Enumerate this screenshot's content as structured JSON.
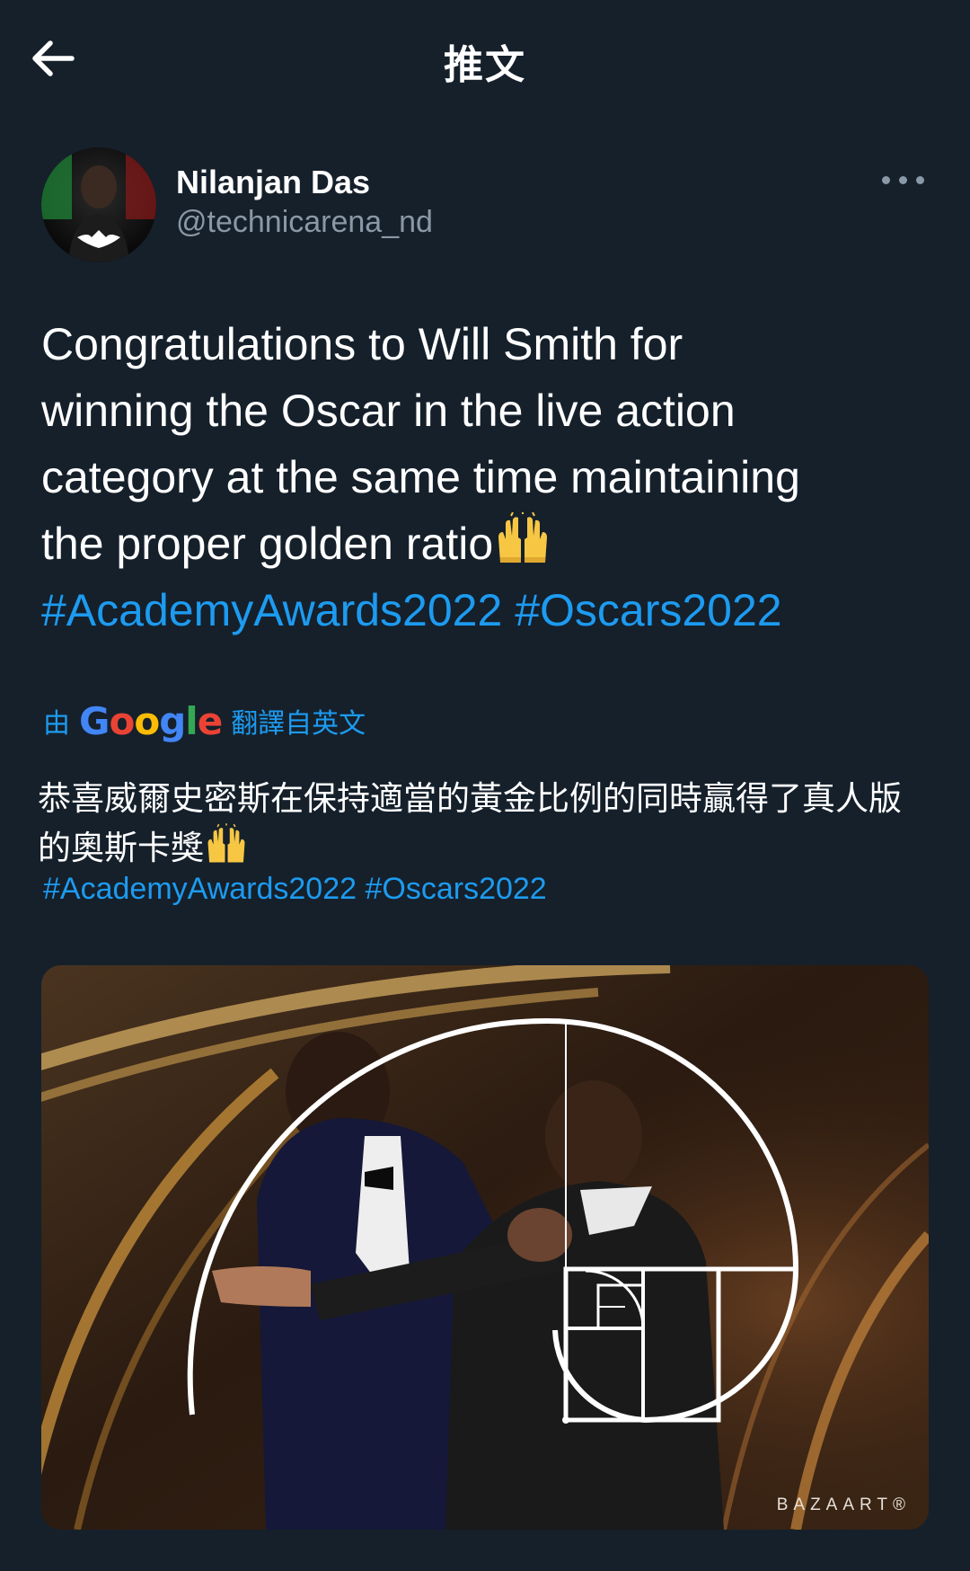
{
  "header": {
    "title": "推文",
    "back_icon": "arrow-left-icon"
  },
  "author": {
    "name": "Nilanjan Das",
    "handle": "@technicarena_nd",
    "avatar": "avatar-image"
  },
  "more_icon": "more-horizontal-icon",
  "tweet": {
    "lines": [
      "Congratulations to Will Smith for",
      "winning the Oscar in the live action",
      "category at the same time maintaining",
      "the proper golden ratio"
    ],
    "emoji": "raising-hands-emoji",
    "hashtags": [
      "#AcademyAwards2022",
      "#Oscars2022"
    ]
  },
  "translation": {
    "by_prefix": "由",
    "provider": "Google",
    "suffix": "翻譯自英文",
    "lines": [
      "恭喜威爾史密斯在保持適當的黃金比例的同時贏得了真人版",
      "的奧斯卡獎"
    ],
    "hashtags": [
      "#AcademyAwards2022",
      "#Oscars2022"
    ]
  },
  "media": {
    "watermark": "BAZAART®"
  },
  "colors": {
    "background": "#15202b",
    "link": "#1d9bf0",
    "secondary": "#8b98a5",
    "text": "#ffffff"
  }
}
